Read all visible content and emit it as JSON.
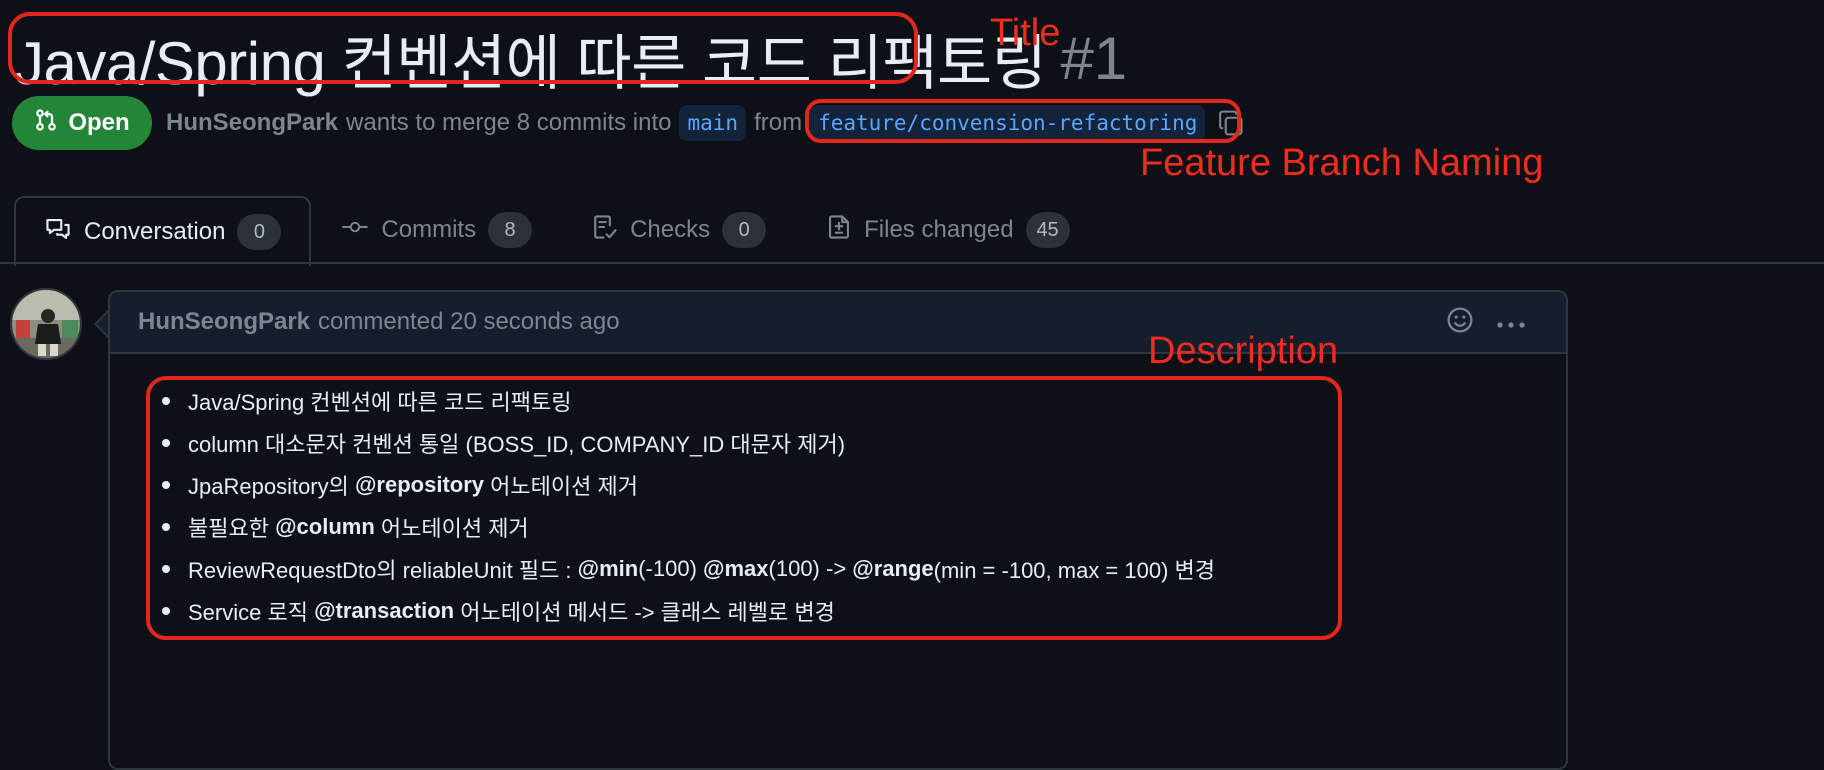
{
  "pr": {
    "title": "Java/Spring 컨벤션에 따른 코드 리팩토링",
    "number": "#1",
    "state": "Open",
    "author": "HunSeongPark",
    "merge_text": "wants to merge 8 commits into",
    "base_branch": "main",
    "from_text": "from",
    "head_branch": "feature/convension-refactoring"
  },
  "annotations": {
    "title": "Title",
    "branch": "Feature Branch Naming",
    "description": "Description"
  },
  "tabs": [
    {
      "label": "Conversation",
      "count": "0",
      "icon": "comment-discussion-icon",
      "selected": true
    },
    {
      "label": "Commits",
      "count": "8",
      "icon": "commit-icon"
    },
    {
      "label": "Checks",
      "count": "0",
      "icon": "checklist-icon"
    },
    {
      "label": "Files changed",
      "count": "45",
      "icon": "file-diff-icon"
    }
  ],
  "comment": {
    "author": "HunSeongPark",
    "meta": "commented 20 seconds ago",
    "items": [
      {
        "parts": [
          "Java/Spring 컨벤션에 따른 코드 리팩토링"
        ]
      },
      {
        "parts": [
          "column 대소문자 컨벤션 통일 (BOSS_ID, COMPANY_ID 대문자 제거)"
        ]
      },
      {
        "parts": [
          "JpaRepository의 ",
          "@repository",
          " 어노테이션 제거"
        ]
      },
      {
        "parts": [
          "불필요한 ",
          "@column",
          " 어노테이션 제거"
        ]
      },
      {
        "parts": [
          "ReviewRequestDto의 reliableUnit 필드 : ",
          "@min",
          "(-100) ",
          "@max",
          "(100) -> ",
          "@range",
          "(min = -100, max = 100) 변경"
        ]
      },
      {
        "parts": [
          "Service 로직 ",
          "@transaction",
          " 어노테이션 메서드 -> 클래스 레벨로 변경"
        ]
      }
    ]
  },
  "colors": {
    "accent_green": "#238636",
    "link_blue": "#58a6ff",
    "annotation_red": "#f22b1f"
  }
}
